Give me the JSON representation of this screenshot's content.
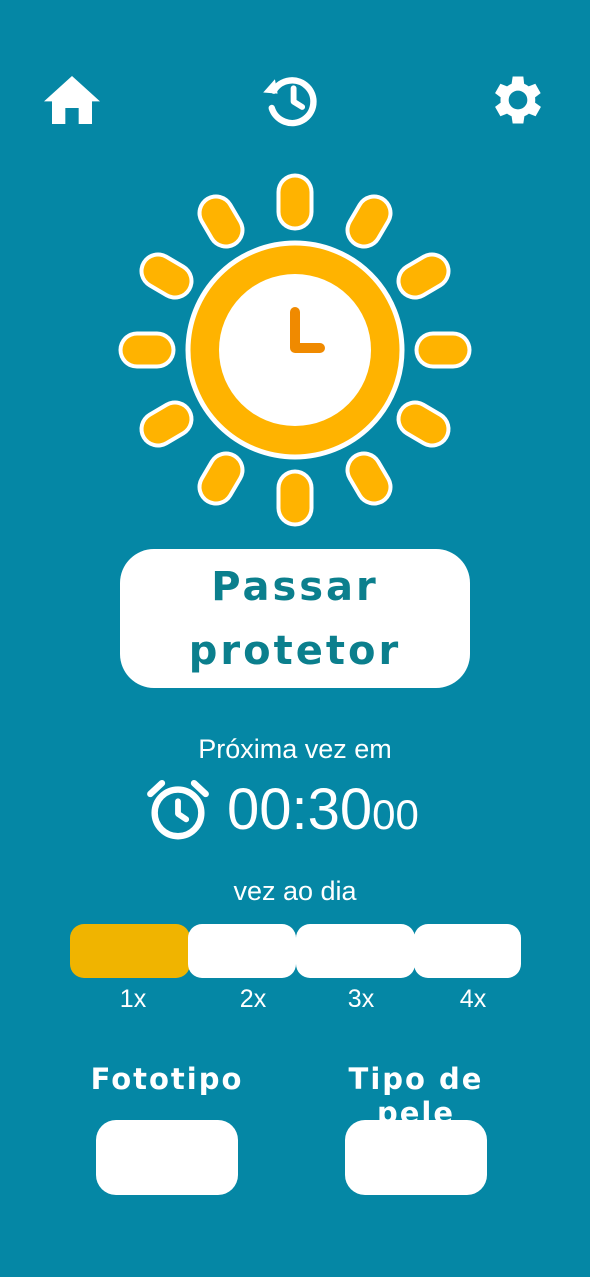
{
  "nav": {
    "home_icon": "home-icon",
    "history_icon": "history-icon",
    "settings_icon": "gear-icon"
  },
  "colors": {
    "background": "#0587a5",
    "sun": "#ffb300",
    "clock_hand": "#f08a00",
    "active_segment": "#f0b400",
    "button_text": "#0b7f8d"
  },
  "main": {
    "apply_button_line1": "Passar",
    "apply_button_line2": "protetor",
    "next_label": "Próxima vez em",
    "timer_main": "00:30",
    "timer_sub": "00"
  },
  "frequency": {
    "label": "vez ao dia",
    "options": [
      "1x",
      "2x",
      "3x",
      "4x"
    ],
    "selected": "1x"
  },
  "fields": {
    "phototype_label": "Fototipo",
    "phototype_value": "",
    "skin_type_label": "Tipo de pele",
    "skin_type_value": ""
  }
}
